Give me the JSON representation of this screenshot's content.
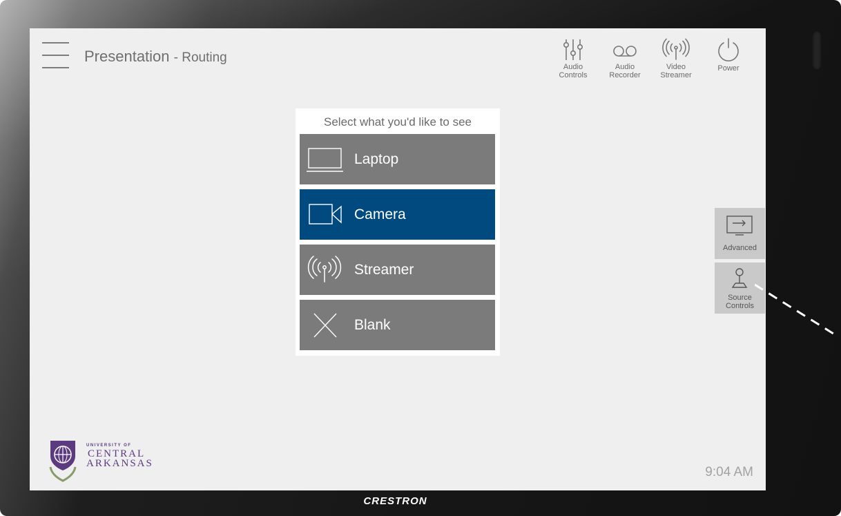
{
  "device": {
    "brand": "CRESTRON"
  },
  "header": {
    "title": "Presentation",
    "subtitle": "- Routing",
    "buttons": [
      {
        "label_line1": "Audio",
        "label_line2": "Controls",
        "icon": "sliders-icon"
      },
      {
        "label_line1": "Audio",
        "label_line2": "Recorder",
        "icon": "voicemail-icon"
      },
      {
        "label_line1": "Video",
        "label_line2": "Streamer",
        "icon": "broadcast-icon"
      },
      {
        "label_line1": "Power",
        "label_line2": "",
        "icon": "power-icon"
      }
    ]
  },
  "panel": {
    "prompt": "Select what you'd like to see",
    "sources": [
      {
        "label": "Laptop",
        "icon": "laptop-icon",
        "active": false
      },
      {
        "label": "Camera",
        "icon": "camera-icon",
        "active": true
      },
      {
        "label": "Streamer",
        "icon": "broadcast-icon",
        "active": false
      },
      {
        "label": "Blank",
        "icon": "x-icon",
        "active": false
      }
    ]
  },
  "side": {
    "advanced": {
      "label": "Advanced",
      "icon": "display-input-icon"
    },
    "source_controls": {
      "label_line1": "Source",
      "label_line2": "Controls",
      "icon": "joystick-icon"
    }
  },
  "logo": {
    "line1": "UNIVERSITY OF",
    "line2": "CENTRAL",
    "line3": "ARKANSAS"
  },
  "clock": "9:04 AM",
  "colors": {
    "active": "#004a80",
    "button": "#7b7b7b",
    "screen": "#efefef",
    "side": "#c9c9c9"
  }
}
